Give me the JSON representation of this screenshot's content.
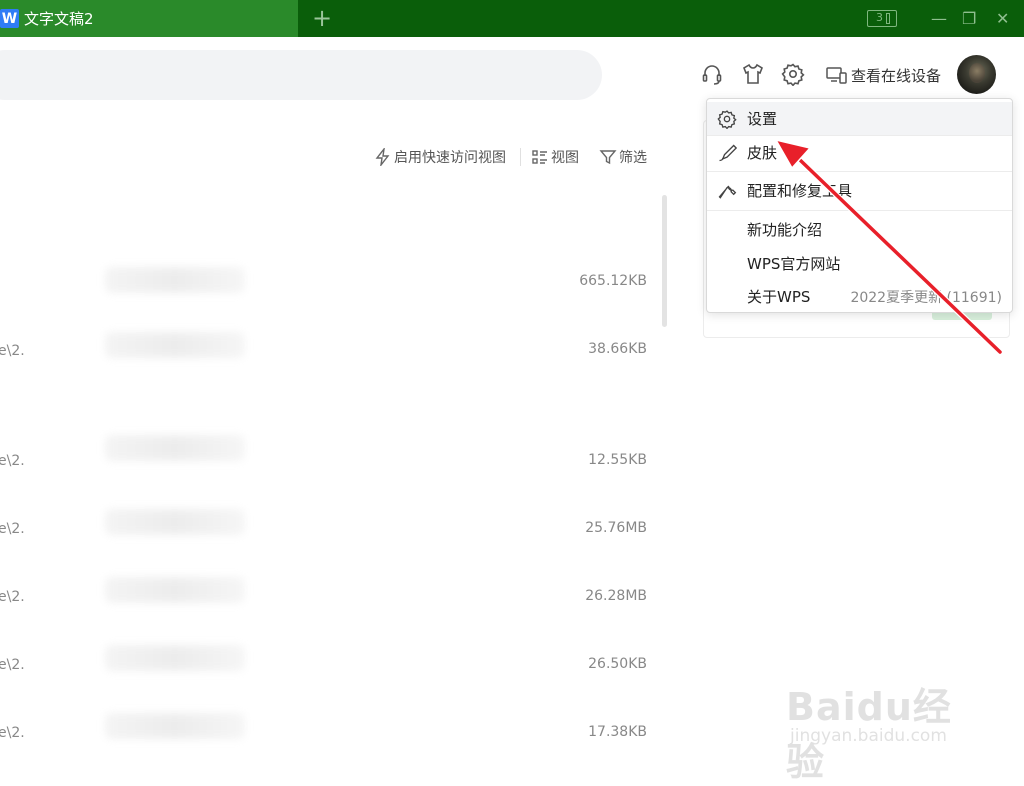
{
  "titlebar": {
    "tab_title": "文字文稿2",
    "tab_icon_letter": "W",
    "add_tab": "+",
    "layout_badge": "3",
    "minimize": "—",
    "restore": "❐",
    "close": "✕"
  },
  "header": {
    "online_devices_label": "查看在线设备"
  },
  "toolbar": {
    "quick_access_label": "启用快速访问视图",
    "view_label": "视图",
    "filter_label": "筛选"
  },
  "files": [
    {
      "path": "",
      "size": "665.12KB"
    },
    {
      "path": "e\\2.",
      "size": "38.66KB"
    },
    {
      "path": "e\\2.",
      "size": "12.55KB"
    },
    {
      "path": "e\\2.",
      "size": "25.76MB"
    },
    {
      "path": "e\\2.",
      "size": "26.28MB"
    },
    {
      "path": "e\\2.",
      "size": "26.50KB"
    },
    {
      "path": "e\\2.",
      "size": "17.38KB"
    }
  ],
  "menu": {
    "settings": "设置",
    "skin": "皮肤",
    "repair_tools": "配置和修复工具",
    "new_features": "新功能介绍",
    "wps_site": "WPS官方网站",
    "about": "关于WPS",
    "version": "2022夏季更新 (11691)"
  },
  "watermark": {
    "brand": "Baidu经验",
    "url": "jingyan.baidu.com"
  },
  "colors": {
    "titlebar_bg": "#0a5e0a",
    "active_tab_bg": "#2a8a2a",
    "arrow_red": "#e8202a"
  }
}
